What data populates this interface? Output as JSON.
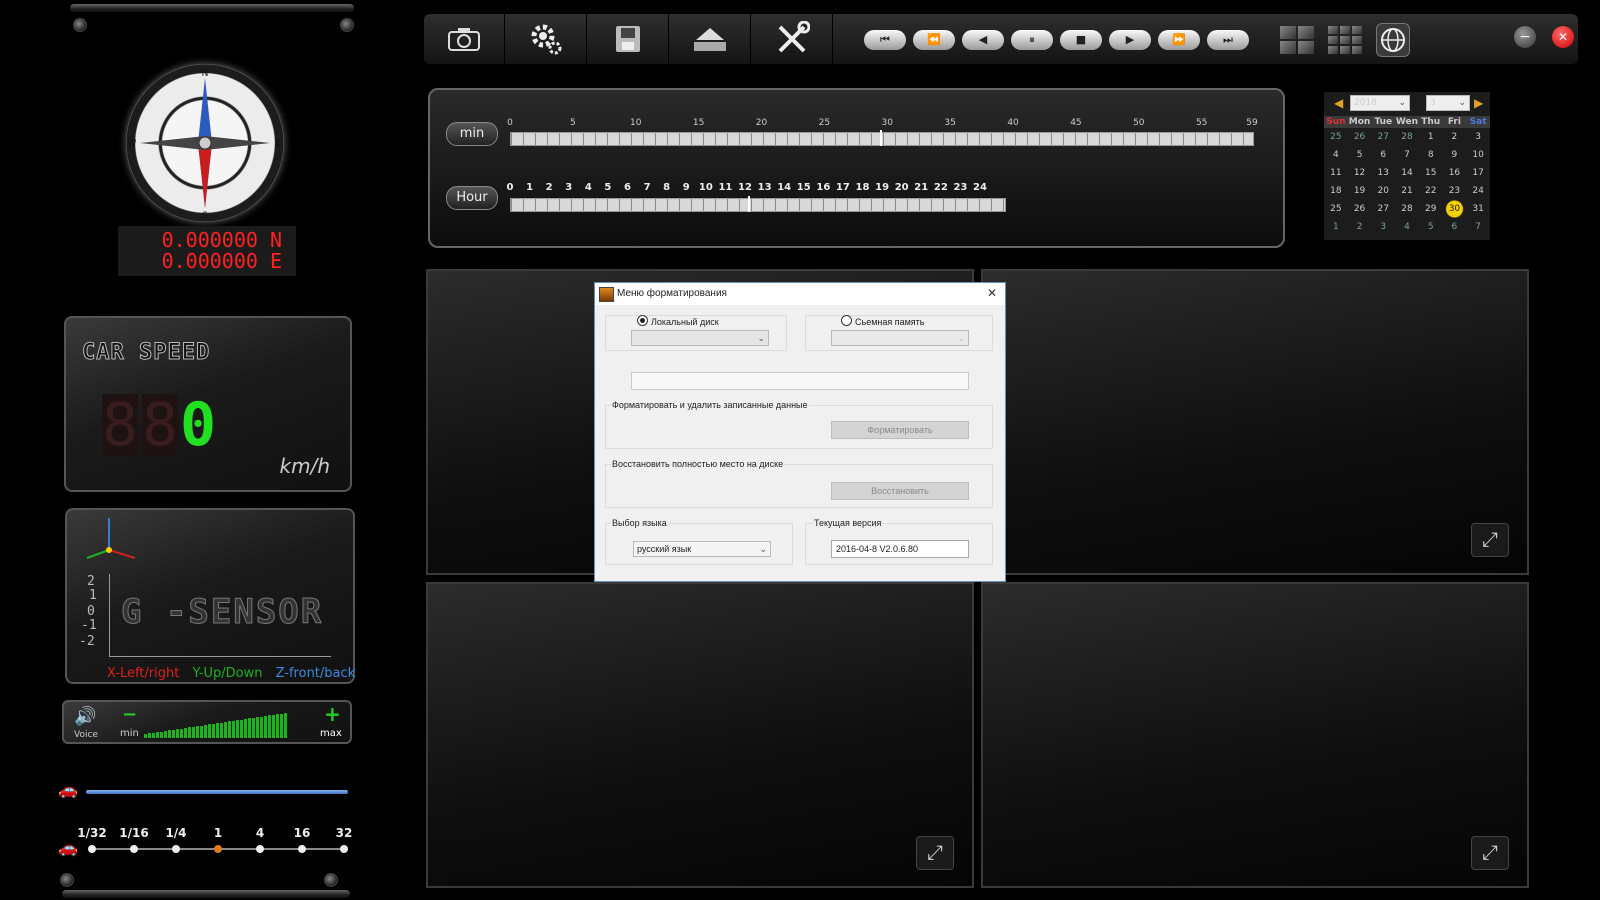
{
  "gps": {
    "lat": "0.000000 N",
    "lon": "0.000000 E"
  },
  "speed": {
    "title": "CAR SPEED",
    "value": "0",
    "unit": "km/h"
  },
  "gsensor": {
    "title": "G -SENSOR",
    "axis_ticks": [
      "2",
      "1",
      "0",
      "-1",
      "-2"
    ],
    "legend": {
      "x": "X-Left/right",
      "y": "Y-Up/Down",
      "z": "Z-front/back"
    }
  },
  "volume": {
    "label": "Voice",
    "min": "min",
    "max": "max",
    "minus": "−",
    "plus": "+"
  },
  "playback_speed": {
    "levels": [
      "1/32",
      "1/16",
      "1/4",
      "1",
      "4",
      "16",
      "32"
    ],
    "selected": "1"
  },
  "toolbar": {
    "tools": [
      "camera-icon",
      "gear-icon",
      "save-disk-icon",
      "eject-icon",
      "tools-icon"
    ],
    "playback": [
      "⏮",
      "⏪",
      "◀",
      "⏸",
      "■",
      "▶",
      "⏩",
      "⏭"
    ],
    "layouts": [
      "grid-4-icon",
      "grid-9-icon"
    ],
    "globe": "globe-icon",
    "minimize": "−",
    "close": "✕"
  },
  "timeline": {
    "min_label": "min",
    "hour_label": "Hour",
    "min_ticks": [
      "0",
      "5",
      "10",
      "15",
      "20",
      "25",
      "30",
      "35",
      "40",
      "45",
      "50",
      "55",
      "59"
    ],
    "hour_ticks": [
      "0",
      "1",
      "2",
      "3",
      "4",
      "5",
      "6",
      "7",
      "8",
      "9",
      "10",
      "11",
      "12",
      "13",
      "14",
      "15",
      "16",
      "17",
      "18",
      "19",
      "20",
      "21",
      "22",
      "23",
      "24"
    ]
  },
  "calendar": {
    "prev": "◀",
    "next": "▶",
    "year": "2018",
    "month": "3",
    "weekdays": [
      "Sun",
      "Mon",
      "Tue",
      "Wen",
      "Thu",
      "Fri",
      "Sat"
    ],
    "days": [
      "25",
      "26",
      "27",
      "28",
      "1",
      "2",
      "3",
      "4",
      "5",
      "6",
      "7",
      "8",
      "9",
      "10",
      "11",
      "12",
      "13",
      "14",
      "15",
      "16",
      "17",
      "18",
      "19",
      "20",
      "21",
      "22",
      "23",
      "24",
      "25",
      "26",
      "27",
      "28",
      "29",
      "30",
      "31",
      "1",
      "2",
      "3",
      "4",
      "5",
      "6",
      "7"
    ],
    "selected": "30"
  },
  "dialog": {
    "title": "Меню форматирования",
    "close": "✕",
    "local_disk": "Локальный диск",
    "removable": "Сьемная память",
    "format_caption": "Форматировать и удалить записанные данные",
    "format_button": "Форматировать",
    "restore_caption": "Восстановить полностью место на диске",
    "restore_button": "Восстановить",
    "language_caption": "Выбор языка",
    "language_value": "русский язык",
    "version_caption": "Текущая версия",
    "version_value": "2016-04-8 V2.0.6.80"
  }
}
